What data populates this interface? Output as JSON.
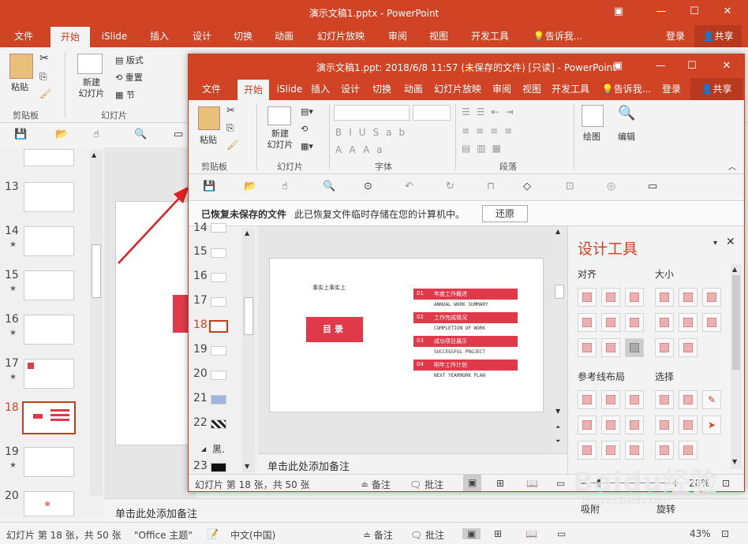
{
  "back": {
    "title": "演示文稿1.pptx - PowerPoint",
    "tabs": [
      "文件",
      "开始",
      "iSlide",
      "插入",
      "设计",
      "切换",
      "动画",
      "幻灯片放映",
      "审阅",
      "视图",
      "开发工具"
    ],
    "selected_tab": "开始",
    "tell_me": "告诉我...",
    "login": "登录",
    "share": "共享",
    "ribbon": {
      "paste": "粘贴",
      "clipboard_group": "剪贴板",
      "new_slide": "新建\n幻灯片",
      "layout": "版式",
      "reset": "重置",
      "section": "节",
      "slides_group": "幻灯片"
    },
    "slide_numbers": [
      "13",
      "14",
      "15",
      "16",
      "17",
      "18",
      "19",
      "20"
    ],
    "starred": [
      "14",
      "15",
      "16",
      "17",
      "19"
    ],
    "selected_slide": "18",
    "notes_placeholder": "单击此处添加备注",
    "status": {
      "slide_info": "幻灯片 第 18 张，共 50 张",
      "theme": "\"Office 主题\"",
      "language": "中文(中国)",
      "notes": "备注",
      "comments": "批注",
      "zoom": "43%"
    }
  },
  "front": {
    "title": "演示文稿1.ppt: 2018/6/8 11:57 (未保存的文件) [只读] - PowerPoint",
    "tabs": [
      "文件",
      "开始",
      "iSlide",
      "插入",
      "设计",
      "切换",
      "动画",
      "幻灯片放映",
      "审阅",
      "视图",
      "开发工具"
    ],
    "selected_tab": "开始",
    "tell_me": "告诉我...",
    "login": "登录",
    "share": "共享",
    "ribbon": {
      "paste": "粘贴",
      "clipboard_group": "剪贴板",
      "new_slide": "新建\n幻灯片",
      "slides_group": "幻灯片",
      "font_group": "字体",
      "paragraph_group": "段落",
      "drawing": "绘图",
      "editing": "编辑"
    },
    "info_bar": {
      "title": "已恢复未保存的文件",
      "message": "此已恢复文件临时存储在您的计算机中。",
      "button": "还原"
    },
    "slide_numbers": [
      "14",
      "15",
      "16",
      "17",
      "18",
      "19",
      "20",
      "21",
      "22",
      "23"
    ],
    "selected_slide": "18",
    "section_label": "黑.",
    "slide": {
      "small_text": "事实上事实上",
      "button_text": "目录",
      "items": [
        {
          "num": "01",
          "cn": "年度工作概述",
          "en": "ANNUAL WORK SUMMARY"
        },
        {
          "num": "02",
          "cn": "工作完成情况",
          "en": "COMPLETION OF WORK"
        },
        {
          "num": "03",
          "cn": "成功项目展示",
          "en": "SUCCESSFUL PROJECT"
        },
        {
          "num": "04",
          "cn": "明年工作计划",
          "en": "NEXT YEARMORK PLAN"
        }
      ]
    },
    "notes_placeholder": "单击此处添加备注",
    "pane": {
      "title": "设计工具",
      "align": "对齐",
      "size": "大小",
      "guides": "参考线布局",
      "select": "选择",
      "snap": "吸附",
      "rotate": "旋转"
    },
    "status": {
      "slide_info": "幻灯片 第 18 张，共 50 张",
      "notes": "备注",
      "comments": "批注",
      "zoom": "28%"
    }
  },
  "colors": {
    "accent": "#d04425",
    "slide_red": "#e03a4a"
  },
  "watermark": {
    "brand": "Baidu经验",
    "url": "jingyan.baidu.com"
  }
}
